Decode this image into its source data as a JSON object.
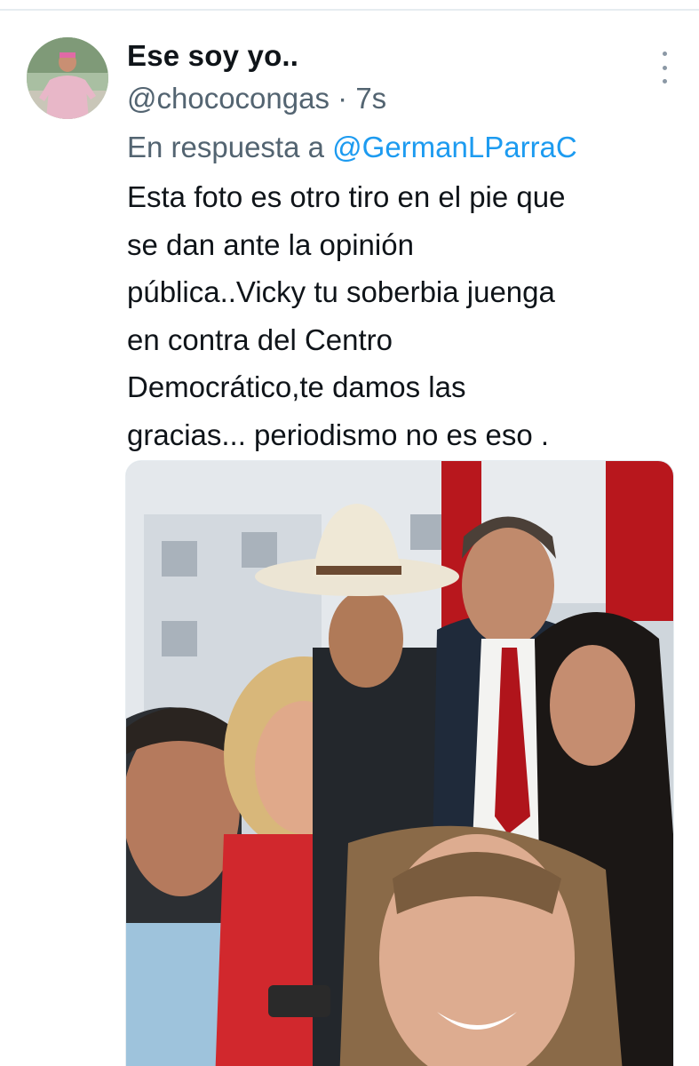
{
  "tweet": {
    "display_name": "Ese soy yo..",
    "handle": "@chococongas",
    "separator": "·",
    "time": "7s",
    "reply_prefix": "En respuesta a",
    "reply_to": "@GermanLParraC",
    "text": "Esta foto es otro tiro en el pie que\nse dan ante la opinión\npública..Vicky tu soberbia juenga\nen contra del Centro\nDemocrático,te damos las\ngracias... periodismo no es eso ."
  },
  "icons": {
    "more": "more-vertical-icon",
    "avatar": "profile-avatar"
  },
  "colors": {
    "text_primary": "#0f1419",
    "text_secondary": "#536471",
    "link": "#1d9bf0"
  }
}
